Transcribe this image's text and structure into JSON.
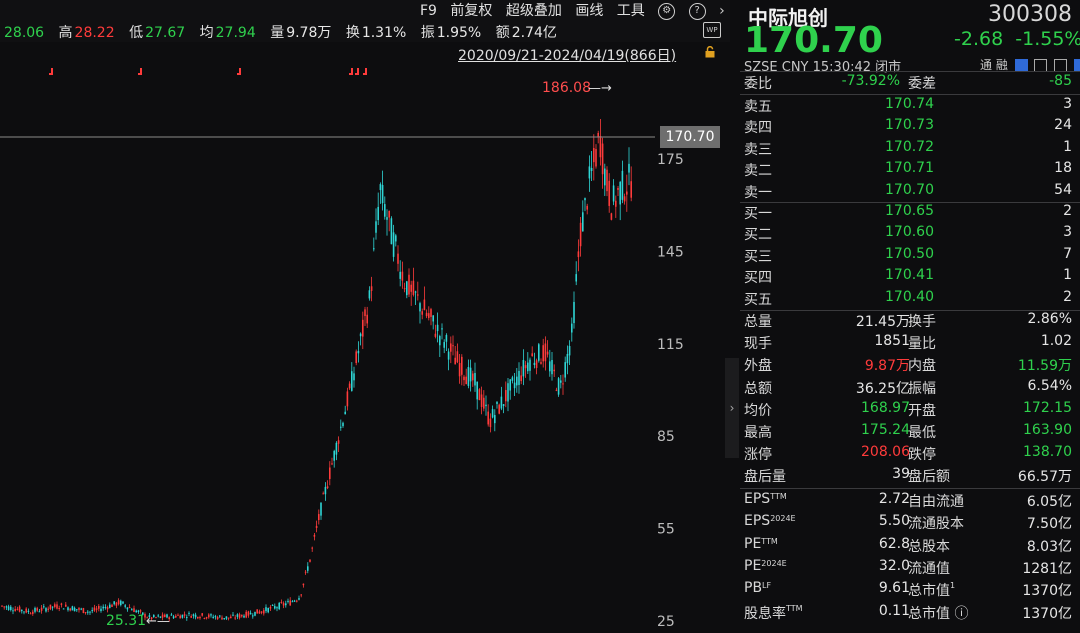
{
  "infobar": {
    "open_value": "28.06",
    "high_label": "高",
    "high_value": "28.22",
    "low_label": "低",
    "low_value": "27.67",
    "avg_label": "均",
    "avg_value": "27.94",
    "vol_label": "量",
    "vol_value": "9.78万",
    "turnover_label": "换",
    "turnover_value": "1.31%",
    "amp_label": "振",
    "amp_value": "1.95%",
    "amount_label": "额",
    "amount_value": "2.74亿"
  },
  "toolbar": {
    "f9": "F9",
    "adjust": "前复权",
    "overlay": "超级叠加",
    "draw": "画线",
    "tools": "工具",
    "range": "2020/09/21-2024/04/19(866日)",
    "wp": "WP"
  },
  "chart": {
    "current_price": "170.70",
    "high_mark": "186.08",
    "low_mark": "25.31",
    "y_ticks": [
      "175",
      "145",
      "115",
      "85",
      "55",
      "25"
    ],
    "colors": {
      "up": "#ff3b3b",
      "down": "#2fd6d6",
      "accent": "#c8c820"
    }
  },
  "panel": {
    "name": "中际旭创",
    "code": "300308",
    "price": "170.70",
    "change": "-2.68",
    "change_pct": "-1.55%",
    "meta": "SZSE  CNY  15:30:42  闭市",
    "flags": "通 融",
    "weibi_label": "委比",
    "weibi_value": "-73.92%",
    "weicha_label": "委差",
    "weicha_value": "-85",
    "asks": [
      {
        "label": "卖五",
        "price": "170.74",
        "vol": "3"
      },
      {
        "label": "卖四",
        "price": "170.73",
        "vol": "24"
      },
      {
        "label": "卖三",
        "price": "170.72",
        "vol": "1"
      },
      {
        "label": "卖二",
        "price": "170.71",
        "vol": "18"
      },
      {
        "label": "卖一",
        "price": "170.70",
        "vol": "54"
      }
    ],
    "bids": [
      {
        "label": "买一",
        "price": "170.65",
        "vol": "2"
      },
      {
        "label": "买二",
        "price": "170.60",
        "vol": "3"
      },
      {
        "label": "买三",
        "price": "170.50",
        "vol": "7"
      },
      {
        "label": "买四",
        "price": "170.41",
        "vol": "1"
      },
      {
        "label": "买五",
        "price": "170.40",
        "vol": "2"
      }
    ],
    "stats1": [
      {
        "l1": "总量",
        "v1": "21.45万",
        "l2": "换手",
        "v2": "2.86%",
        "c1": "white",
        "c2": "white"
      },
      {
        "l1": "现手",
        "v1": "1851",
        "l2": "量比",
        "v2": "1.02",
        "c1": "white",
        "c2": "white"
      },
      {
        "l1": "外盘",
        "v1": "9.87万",
        "l2": "内盘",
        "v2": "11.59万",
        "c1": "red",
        "c2": "green"
      },
      {
        "l1": "总额",
        "v1": "36.25亿",
        "l2": "振幅",
        "v2": "6.54%",
        "c1": "white",
        "c2": "white"
      },
      {
        "l1": "均价",
        "v1": "168.97",
        "l2": "开盘",
        "v2": "172.15",
        "c1": "green",
        "c2": "green"
      },
      {
        "l1": "最高",
        "v1": "175.24",
        "l2": "最低",
        "v2": "163.90",
        "c1": "green",
        "c2": "green"
      },
      {
        "l1": "涨停",
        "v1": "208.06",
        "l2": "跌停",
        "v2": "138.70",
        "c1": "red",
        "c2": "green"
      },
      {
        "l1": "盘后量",
        "v1": "39",
        "l2": "盘后额",
        "v2": "66.57万",
        "c1": "white",
        "c2": "white"
      }
    ],
    "stats2": [
      {
        "l1": "EPS",
        "s1": "TTM",
        "v1": "2.72",
        "l2": "自由流通",
        "s2": "",
        "v2": "6.05亿"
      },
      {
        "l1": "EPS",
        "s1": "2024E",
        "v1": "5.50",
        "l2": "流通股本",
        "s2": "",
        "v2": "7.50亿"
      },
      {
        "l1": "PE",
        "s1": "TTM",
        "v1": "62.8",
        "l2": "总股本",
        "s2": "",
        "v2": "8.03亿"
      },
      {
        "l1": "PE",
        "s1": "2024E",
        "v1": "32.0",
        "l2": "流通值",
        "s2": "",
        "v2": "1281亿"
      },
      {
        "l1": "PB",
        "s1": "LF",
        "v1": "9.61",
        "l2": "总市值",
        "s2": "1",
        "v2": "1370亿"
      },
      {
        "l1": "股息率",
        "s1": "TTM",
        "v1": "0.11",
        "l2": "总市值",
        "s2": "",
        "v2": "1370亿"
      }
    ]
  }
}
